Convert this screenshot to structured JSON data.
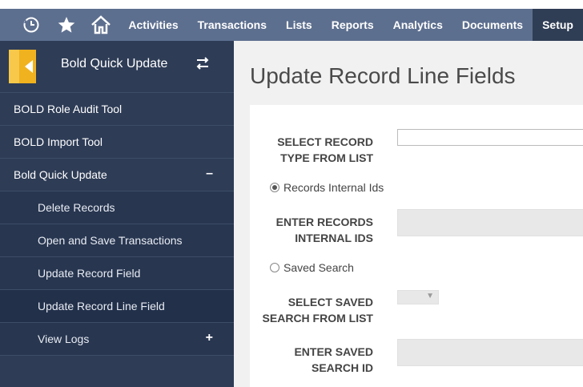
{
  "nav": {
    "icons": [
      "recent-icon",
      "star-icon",
      "home-icon"
    ],
    "items": [
      {
        "label": "Activities"
      },
      {
        "label": "Transactions"
      },
      {
        "label": "Lists"
      },
      {
        "label": "Reports"
      },
      {
        "label": "Analytics"
      },
      {
        "label": "Documents"
      },
      {
        "label": "Setup",
        "active": true
      }
    ]
  },
  "sidebar": {
    "title": "Bold Quick Update",
    "items": [
      {
        "label": "BOLD Role Audit Tool"
      },
      {
        "label": "BOLD Import Tool"
      },
      {
        "label": "Bold Quick Update",
        "toggle": "–"
      },
      {
        "label": "Delete Records"
      },
      {
        "label": "Open and Save Transactions"
      },
      {
        "label": "Update Record Field"
      },
      {
        "label": "Update Record Line Field",
        "selected": true
      },
      {
        "label": "View Logs",
        "toggle": "+"
      }
    ]
  },
  "main": {
    "title": "Update Record Line Fields",
    "select_record_type_label_1": "SELECT RECORD",
    "select_record_type_label_2": "TYPE FROM LIST",
    "radio_internal_ids": "Records Internal Ids",
    "enter_ids_label_1": "ENTER RECORDS",
    "enter_ids_label_2": "INTERNAL IDS",
    "radio_saved_search": "Saved Search",
    "select_saved_label_1": "SELECT SAVED",
    "select_saved_label_2": "SEARCH FROM LIST",
    "enter_saved_label_1": "ENTER SAVED",
    "enter_saved_label_2": "SEARCH ID",
    "radio_internal_ids_checked": true,
    "radio_saved_search_checked": false
  },
  "colors": {
    "topnav": "#5d6f8f",
    "sidebar": "#2e3c56",
    "logo": "#f0b21e"
  }
}
